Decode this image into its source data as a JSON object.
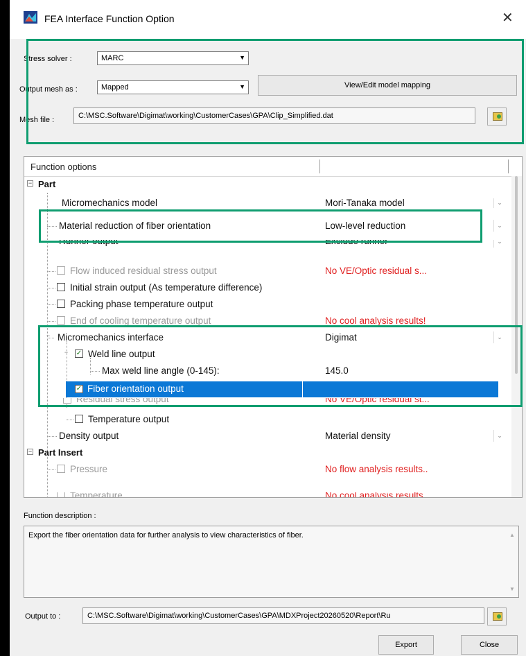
{
  "window": {
    "title": "FEA Interface Function Option"
  },
  "settings": {
    "stress_solver_label": "Stress solver :",
    "stress_solver_value": "MARC",
    "output_mesh_label": "Output mesh as :",
    "output_mesh_value": "Mapped",
    "model_mapping_button": "View/Edit model mapping",
    "mesh_file_label": "Mesh file :",
    "mesh_file_value": "C:\\MSC.Software\\Digimat\\working\\CustomerCases\\GPA\\Clip_Simplified.dat"
  },
  "grid": {
    "header": "Function options",
    "rows": [
      {
        "name": "Part",
        "value": ""
      },
      {
        "name": "Micromechanics model",
        "value": "Mori-Tanaka model"
      },
      {
        "name": "Material reduction of fiber orientation",
        "value": "Low-level reduction"
      },
      {
        "name": "Runner output",
        "value": "Exclude runner"
      },
      {
        "name": "Flow induced residual stress output",
        "value": "No VE/Optic residual s..."
      },
      {
        "name": "Initial strain output (As temperature difference)",
        "value": ""
      },
      {
        "name": "Packing phase temperature output",
        "value": ""
      },
      {
        "name": "End of cooling temperature output",
        "value": "No cool analysis results!"
      },
      {
        "name": "Micromechanics interface",
        "value": "Digimat"
      },
      {
        "name": "Weld line output",
        "value": ""
      },
      {
        "name": "Max weld line angle (0-145):",
        "value": "145.0"
      },
      {
        "name": "Fiber orientation output",
        "value": ""
      },
      {
        "name": "Residual stress output",
        "value": "No VE/Optic residual st..."
      },
      {
        "name": "Temperature output",
        "value": ""
      },
      {
        "name": "Density output",
        "value": "Material density"
      },
      {
        "name": "Part Insert",
        "value": ""
      },
      {
        "name": "Pressure",
        "value": "No flow analysis results.."
      },
      {
        "name": "Temperature",
        "value": "No cool analysis results.."
      }
    ]
  },
  "description": {
    "label": "Function description :",
    "text": "Export the fiber orientation data for further analysis to view characteristics of fiber."
  },
  "output": {
    "label": "Output to :",
    "path": "C:\\MSC.Software\\Digimat\\working\\CustomerCases\\GPA\\MDXProject20260520\\Report\\Ru"
  },
  "footer": {
    "export_button": "Export",
    "close_button": "Close"
  },
  "colors": {
    "highlight_border": "#0f9d70",
    "selection": "#0b78d6",
    "warning_text": "#e02020"
  }
}
